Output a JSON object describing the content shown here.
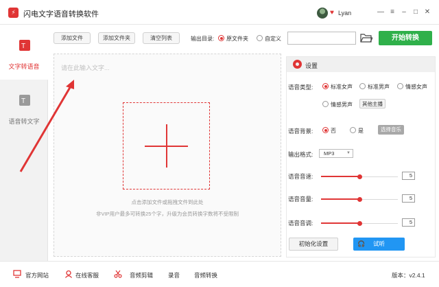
{
  "app": {
    "title": "闪电文字语音转换软件",
    "logo_glyph": "⚡"
  },
  "user": {
    "name": "Lyan"
  },
  "window": {
    "min": "—",
    "menu": "≡",
    "minimize": "–",
    "maximize": "□",
    "close": "✕"
  },
  "sidebar": {
    "items": [
      {
        "label": "文字转语音",
        "active": true
      },
      {
        "label": "语音转文字",
        "active": false
      }
    ]
  },
  "toolbar": {
    "add_file": "添加文件",
    "add_folder": "添加文件夹",
    "clear_list": "清空列表",
    "output_label": "输出目录:",
    "option_original": "原文件夹",
    "option_custom": "自定义",
    "start": "开始转换"
  },
  "editor": {
    "placeholder": "请在此输入文字...",
    "drop_hint": "点击添加文件或拖拽文件到此处",
    "vip_hint": "非VIP用户最多可转换25个字，升级为会员转换字数将不受限制"
  },
  "settings": {
    "title": "设置",
    "voice_type_label": "语音类型:",
    "voices": [
      "标准女声",
      "标准男声",
      "情感女声",
      "情感男声"
    ],
    "selected_voice": "标准女声",
    "other_anchor": "其他主播",
    "bg_label": "语音背景:",
    "bg_no": "否",
    "bg_yes": "是",
    "choose_music": "选择音乐",
    "format_label": "输出格式:",
    "format_value": "MP3",
    "speed_label": "语音音速:",
    "speed_value": "5",
    "speed_level": 0.5,
    "volume_label": "语音音量:",
    "volume_value": "5",
    "volume_level": 0.5,
    "pitch_label": "语音音调:",
    "pitch_value": "5",
    "pitch_level": 0.5,
    "reset": "初始化设置",
    "listen": "试听"
  },
  "footer": {
    "website": "官方网站",
    "support": "在线客服",
    "audio_cut": "音频剪辑",
    "record": "录音",
    "audio_convert": "音频转换",
    "version": "版本：v2.4.1"
  },
  "colors": {
    "accent": "#e03535",
    "start_green": "#2fb04a",
    "listen_blue": "#2196f3"
  }
}
